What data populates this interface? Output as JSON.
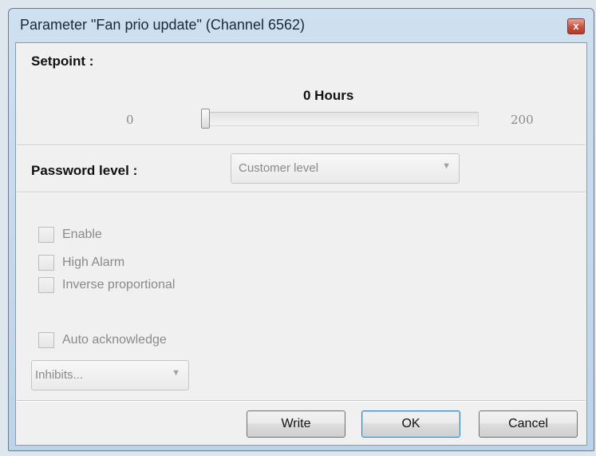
{
  "window": {
    "title": "Parameter \"Fan prio update\" (Channel 6562)",
    "close_glyph": "x"
  },
  "setpoint": {
    "label": "Setpoint :",
    "value_text": "0 Hours",
    "min_label": "0",
    "max_label": "200",
    "value": 0,
    "min": 0,
    "max": 200
  },
  "password": {
    "label": "Password level :",
    "selected": "Customer level"
  },
  "options": {
    "enable": {
      "label": "Enable",
      "checked": false
    },
    "high_alarm": {
      "label": "High Alarm",
      "checked": false
    },
    "inverse_proportional": {
      "label": "Inverse proportional",
      "checked": false
    },
    "auto_acknowledge": {
      "label": "Auto acknowledge",
      "checked": false
    }
  },
  "inhibits": {
    "selected": "Inhibits..."
  },
  "buttons": {
    "write": "Write",
    "ok": "OK",
    "cancel": "Cancel"
  },
  "icons": {
    "close": "close-icon",
    "dropdown": "chevron-down-icon"
  },
  "colors": {
    "title_bar": "#c4d8ec",
    "close_button": "#c7503e",
    "dialog_background": "#f0f0f0",
    "disabled_text": "#8a8a8a",
    "default_button_border": "#3c7fb1"
  }
}
